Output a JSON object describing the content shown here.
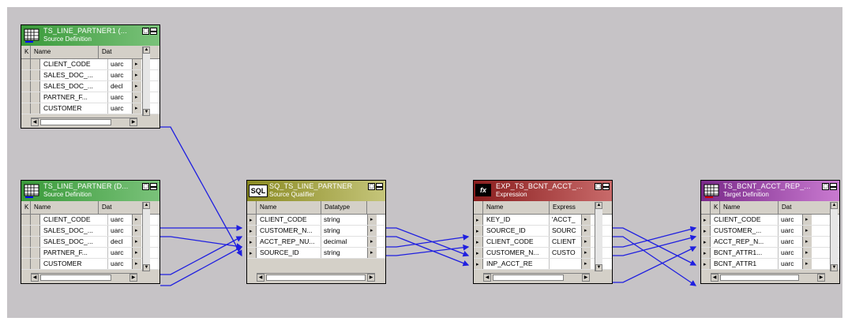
{
  "nodes": {
    "src1": {
      "title": "TS_LINE_PARTNER1 (...",
      "subtitle": "Source Definition",
      "col_key": "K",
      "col_name": "Name",
      "col_type": "Dat",
      "rows": [
        {
          "name": "CLIENT_CODE",
          "type": "uarc"
        },
        {
          "name": "SALES_DOC_...",
          "type": "uarc"
        },
        {
          "name": "SALES_DOC_...",
          "type": "decl"
        },
        {
          "name": "PARTNER_F...",
          "type": "uarc"
        },
        {
          "name": "CUSTOMER",
          "type": "uarc"
        }
      ]
    },
    "src2": {
      "title": "TS_LINE_PARTNER (D...",
      "subtitle": "Source Definition",
      "col_key": "K",
      "col_name": "Name",
      "col_type": "Dat",
      "rows": [
        {
          "name": "CLIENT_CODE",
          "type": "uarc"
        },
        {
          "name": "SALES_DOC_...",
          "type": "uarc"
        },
        {
          "name": "SALES_DOC_...",
          "type": "decl"
        },
        {
          "name": "PARTNER_F...",
          "type": "uarc"
        },
        {
          "name": "CUSTOMER",
          "type": "uarc"
        }
      ]
    },
    "sq": {
      "icon": "SQL",
      "title": "SQ_TS_LINE_PARTNER",
      "subtitle": "Source Qualifier",
      "col_name": "Name",
      "col_type": "Datatype",
      "rows": [
        {
          "name": "CLIENT_CODE",
          "type": "string"
        },
        {
          "name": "CUSTOMER_N...",
          "type": "string"
        },
        {
          "name": "ACCT_REP_NU...",
          "type": "decimal"
        },
        {
          "name": "SOURCE_ID",
          "type": "string"
        }
      ]
    },
    "exp": {
      "icon": "fx",
      "title": "EXP_TS_BCNT_ACCT_...",
      "subtitle": "Expression",
      "col_name": "Name",
      "col_type": "Express",
      "rows": [
        {
          "name": "KEY_ID",
          "type": "'ACCT_"
        },
        {
          "name": "SOURCE_ID",
          "type": "SOURC"
        },
        {
          "name": "CLIENT_CODE",
          "type": "CLIENT"
        },
        {
          "name": "CUSTOMER_N...",
          "type": "CUSTO"
        },
        {
          "name": "INP_ACCT_RE",
          "type": ""
        }
      ]
    },
    "tgt": {
      "title": "TS_BCNT_ACCT_REP_...",
      "subtitle": "Target Definition",
      "col_key": "K",
      "col_name": "Name",
      "col_type": "Dat",
      "rows": [
        {
          "name": "CLIENT_CODE",
          "type": "uarc"
        },
        {
          "name": "CUSTOMER_...",
          "type": "uarc"
        },
        {
          "name": "ACCT_REP_N...",
          "type": "uarc"
        },
        {
          "name": "BCNT_ATTR1...",
          "type": "uarc"
        },
        {
          "name": "BCNT_ATTR1",
          "type": "uarc"
        }
      ]
    }
  },
  "colors": {
    "canvas": "#c6c3c6",
    "link": "#1f1fe0",
    "source_header": "#3a9a3a",
    "qualifier_header": "#8a8a22",
    "expression_header": "#8a1e1e",
    "target_header": "#7a2a8a"
  },
  "icons": {
    "source": "table-grid-icon",
    "qualifier": "sql-icon",
    "expression": "fx-icon",
    "target": "table-grid-target-icon"
  }
}
